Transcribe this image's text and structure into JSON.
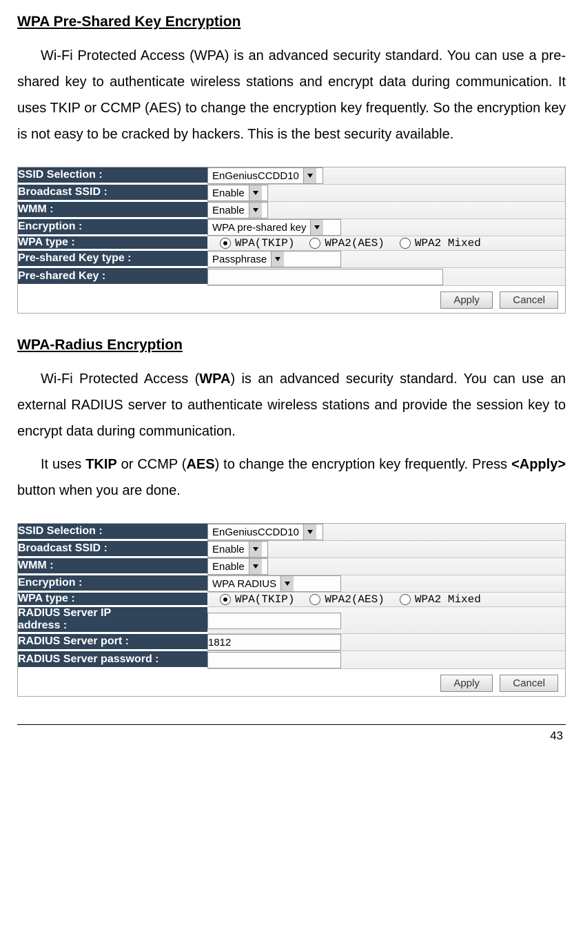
{
  "headings": {
    "h1": "WPA Pre-Shared Key Encryption",
    "h2": "WPA-Radius Encryption"
  },
  "para1": {
    "text": "Wi-Fi Protected Access (WPA) is an advanced security standard. You can use a pre-shared key to authenticate wireless stations and encrypt data during communication. It uses TKIP or CCMP (AES) to change the encryption key frequently. So the encryption key is not easy to be cracked by hackers. This is the best security available."
  },
  "para2a": {
    "pre": "Wi-Fi Protected Access (",
    "b1": "WPA",
    "post": ") is an advanced security standard. You can use an external RADIUS server to authenticate wireless stations and provide the session key to encrypt data during communication."
  },
  "para2b": {
    "pre": "It uses ",
    "b1": "TKIP",
    "mid1": " or CCMP (",
    "b2": "AES",
    "mid2": ") to change the encryption key frequently. Press ",
    "b3": "<Apply>",
    "post": " button when you are done."
  },
  "panel1": {
    "rows": {
      "ssid_label": "SSID Selection :",
      "ssid_value": "EnGeniusCCDD10",
      "broadcast_label": "Broadcast SSID :",
      "broadcast_value": "Enable",
      "wmm_label": "WMM :",
      "wmm_value": "Enable",
      "enc_label": "Encryption :",
      "enc_value": "WPA pre-shared key",
      "wpatype_label": "WPA type :",
      "wpatype_opts": [
        "WPA(TKIP)",
        "WPA2(AES)",
        "WPA2 Mixed"
      ],
      "wpatype_selected": 0,
      "pskt_label": "Pre-shared Key type :",
      "pskt_value": "Passphrase",
      "psk_label": "Pre-shared Key :",
      "psk_value": ""
    },
    "buttons": {
      "apply": "Apply",
      "cancel": "Cancel"
    }
  },
  "panel2": {
    "rows": {
      "ssid_label": "SSID Selection :",
      "ssid_value": "EnGeniusCCDD10",
      "broadcast_label": "Broadcast SSID :",
      "broadcast_value": "Enable",
      "wmm_label": "WMM :",
      "wmm_value": "Enable",
      "enc_label": "Encryption :",
      "enc_value": "WPA RADIUS",
      "wpatype_label": "WPA type :",
      "wpatype_opts": [
        "WPA(TKIP)",
        "WPA2(AES)",
        "WPA2 Mixed"
      ],
      "wpatype_selected": 0,
      "radip_label": "RADIUS Server IP\naddress :",
      "radip_value": "",
      "radport_label": "RADIUS Server port :",
      "radport_value": "1812",
      "radpw_label": "RADIUS Server password :",
      "radpw_value": ""
    },
    "buttons": {
      "apply": "Apply",
      "cancel": "Cancel"
    }
  },
  "page_number": "43"
}
